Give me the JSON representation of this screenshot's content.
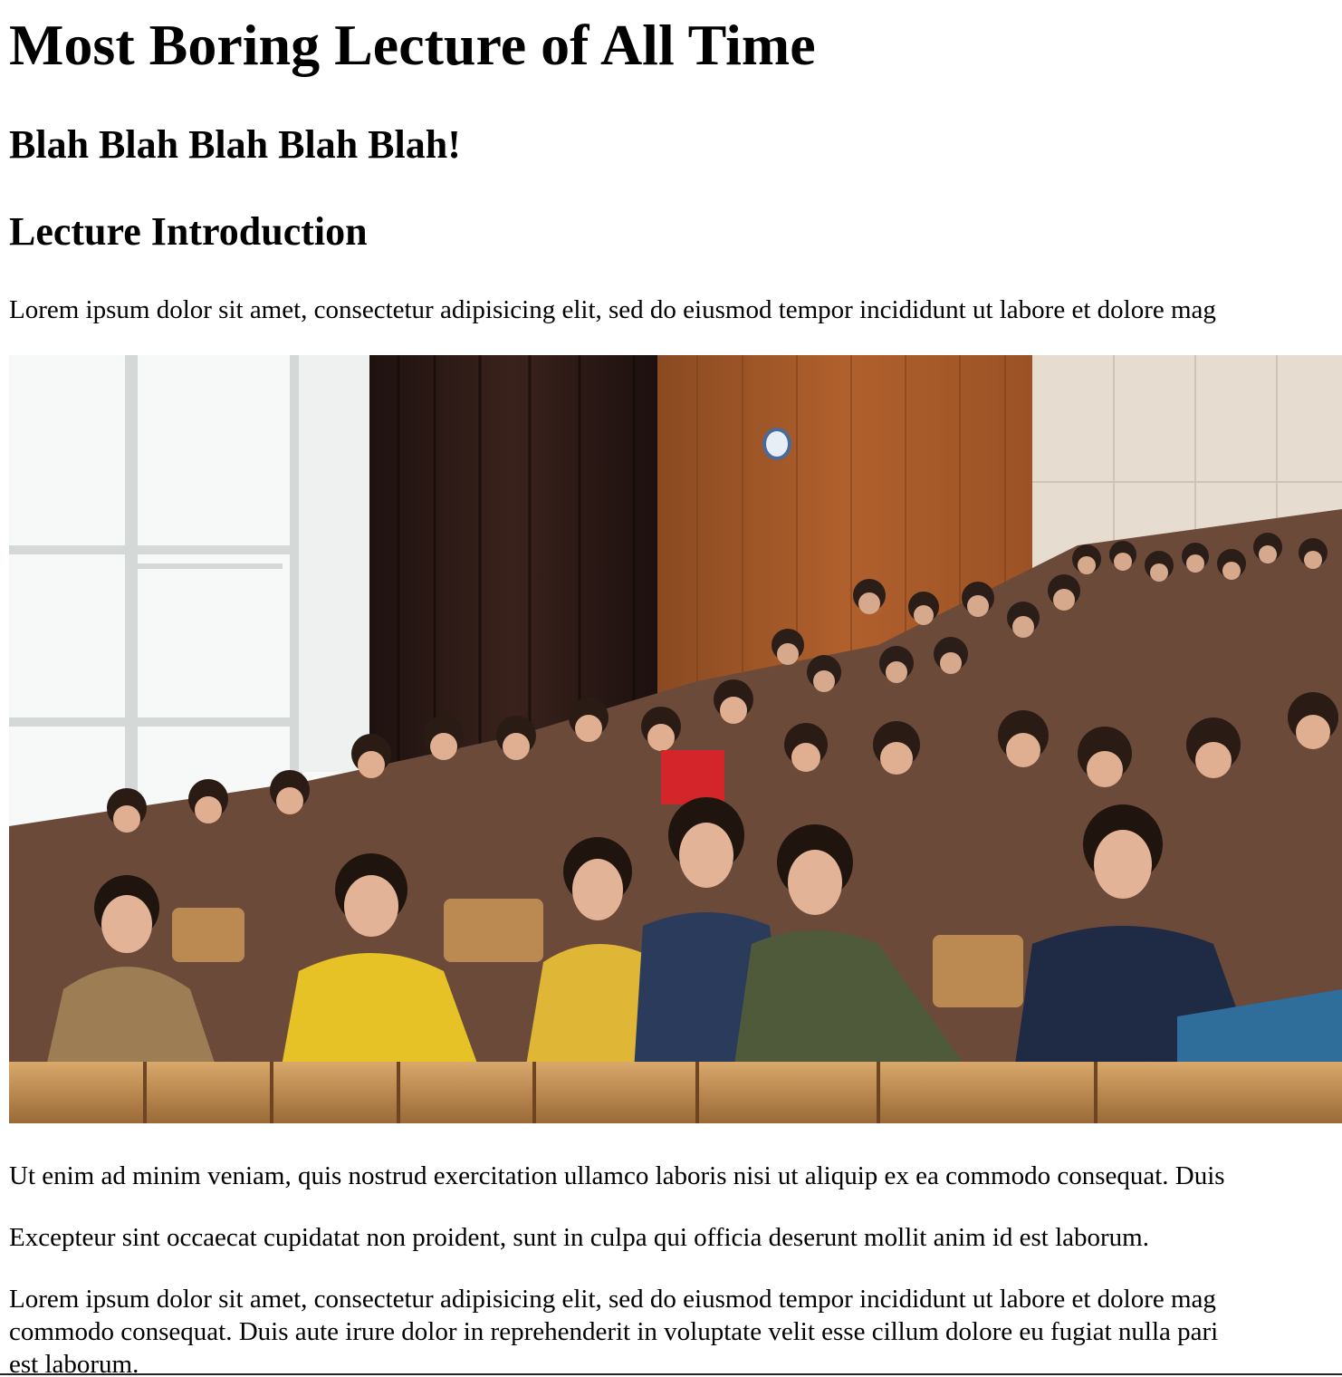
{
  "page": {
    "title": "Most Boring Lecture of All Time",
    "subtitle": "Blah Blah Blah Blah Blah!",
    "section_heading": "Lecture Introduction",
    "intro_paragraph": "Lorem ipsum dolor sit amet, consectetur adipisicing elit, sed do eiusmod tempor incididunt ut labore et dolore mag",
    "paragraph_2": "Ut enim ad minim veniam, quis nostrud exercitation ullamco laboris nisi ut aliquip ex ea commodo consequat. Duis",
    "paragraph_3": "Excepteur sint occaecat cupidatat non proident, sunt in culpa qui officia deserunt mollit anim id est laborum.",
    "paragraph_4_lines": [
      "Lorem ipsum dolor sit amet, consectetur adipisicing elit, sed do eiusmod tempor incididunt ut labore et dolore mag",
      "commodo consequat. Duis aute irure dolor in reprehenderit in voluptate velit esse cillum dolore eu fugiat nulla pari",
      "est laborum."
    ]
  },
  "image": {
    "subject": "students seated in a lecture hall",
    "colors": {
      "wall_wood": "#a0522d",
      "curtain": "#2a1a16",
      "window": "#f4f6f6",
      "seat_wood": "#c8955a"
    }
  }
}
